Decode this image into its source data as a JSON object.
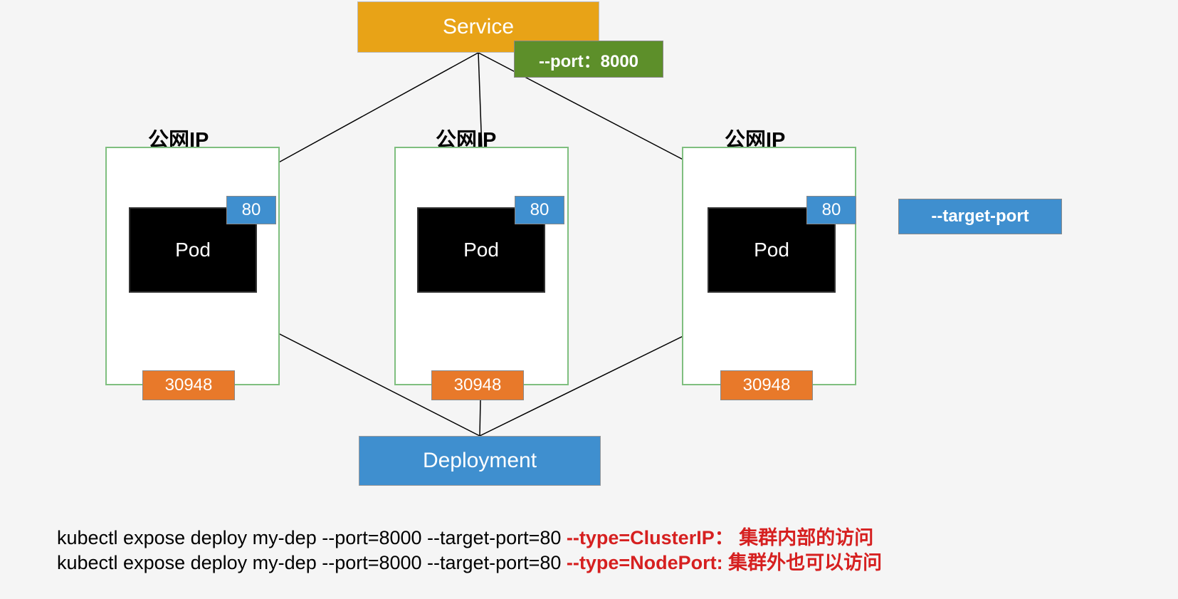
{
  "service": {
    "label": "Service",
    "port_flag": "--port：8000"
  },
  "nodes": [
    {
      "title": "公网IP",
      "pod": "Pod",
      "targetPort": "80",
      "nodePort": "30948"
    },
    {
      "title": "公网IP",
      "pod": "Pod",
      "targetPort": "80",
      "nodePort": "30948"
    },
    {
      "title": "公网IP",
      "pod": "Pod",
      "targetPort": "80",
      "nodePort": "30948"
    }
  ],
  "targetPortLabel": "--target-port",
  "deployment": {
    "label": "Deployment"
  },
  "commands": {
    "line1_black": "kubectl expose deploy my-dep --port=8000 --target-port=80 ",
    "line1_red": "--type=ClusterIP： 集群内部的访问",
    "line2_black": "kubectl expose deploy my-dep --port=8000 --target-port=80 ",
    "line2_red": "--type=NodePort:  集群外也可以访问"
  }
}
